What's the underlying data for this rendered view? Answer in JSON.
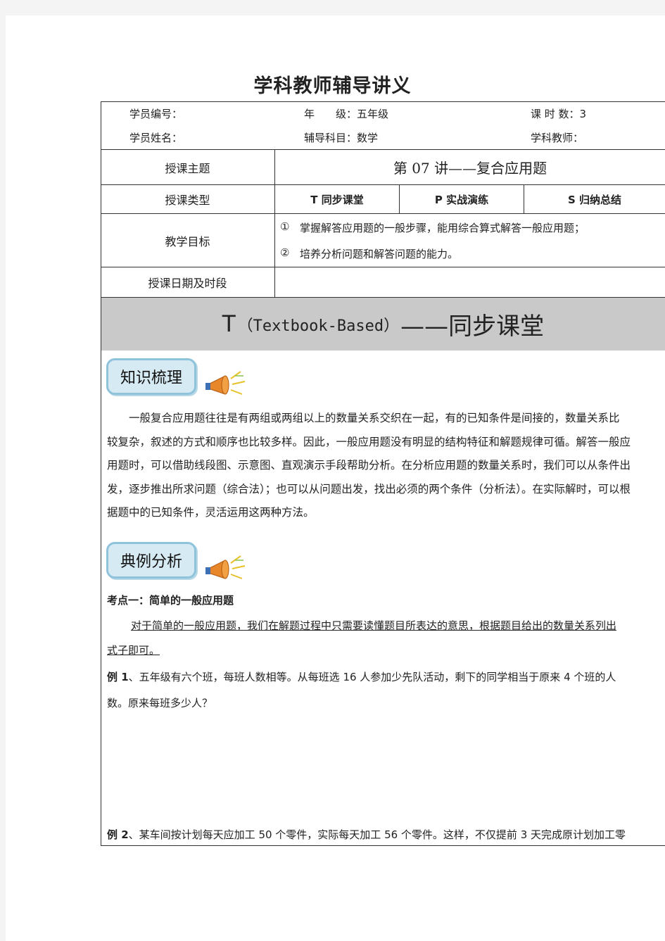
{
  "doc_title": "学科教师辅导讲义",
  "info": {
    "student_id_label": "学员编号：",
    "grade_label": "年　　级：五年级",
    "hours_label": "课 时 数：3",
    "student_name_label": "学员姓名：",
    "subject_label": "辅导科目：数学",
    "teacher_label": "学科教师："
  },
  "table": {
    "topic_label": "授课主题",
    "topic_value": "第 07 讲——复合应用题",
    "type_label": "授课类型",
    "type_t": "T 同步课堂",
    "type_p": "P 实战演练",
    "type_s": "S 归纳总结",
    "goal_label": "教学目标",
    "goal_1_num": "①",
    "goal_1": "掌握解答应用题的一般步骤，能用综合算式解答一般应用题；",
    "goal_2_num": "②",
    "goal_2": "培养分析问题和解答问题的能力。",
    "date_label": "授课日期及时段",
    "date_value": ""
  },
  "banner": {
    "letter": "T",
    "paren": "（Textbook-Based）",
    "title": "——同步课堂"
  },
  "section1": {
    "tag": "知识梳理",
    "icon": "megaphone-icon",
    "lines": [
      "一般复合应用题往往是有两组或两组以上的数量关系交织在一起，有的已知条件是间接的，数量关系比",
      "较复杂，叙述的方式和顺序也比较多样。因此，一般应用题没有明显的结构特征和解题规律可循。解答一般应",
      "用题时，可以借助线段图、示意图、直观演示手段帮助分析。在分析应用题的数量关系时，我们可以从条件出",
      "发，逐步推出所求问题（综合法）；也可以从问题出发，找出必须的两个条件（分析法）。在实际解时，可以根",
      "据题中的已知条件，灵活运用这两种方法。"
    ]
  },
  "section2": {
    "tag": "典例分析",
    "icon": "megaphone-icon",
    "point_title": "考点一：简单的一般应用题",
    "point_desc_1": "对于简单的一般应用题，我们在解题过程中只需要读懂题目所表达的意思，根据题目给出的数量关系列出",
    "point_desc_2": "式子即可。",
    "ex1_label": "例 1",
    "ex1_line1": "、五年级有六个班，每班人数相等。从每班选 16 人参加少先队活动，剩下的同学相当于原来 4 个班的人",
    "ex1_line2": "数。原来每班多少人？",
    "ex2_label": "例 2",
    "ex2_line1": "、某车间按计划每天应加工 50 个零件，实际每天加工 56 个零件。这样，不仅提前 3 天完成原计划加工零"
  },
  "colors": {
    "banner_bg": "#c9c9c9",
    "tag_bg": "#d6eaf3",
    "tag_border": "#8fc3db"
  }
}
